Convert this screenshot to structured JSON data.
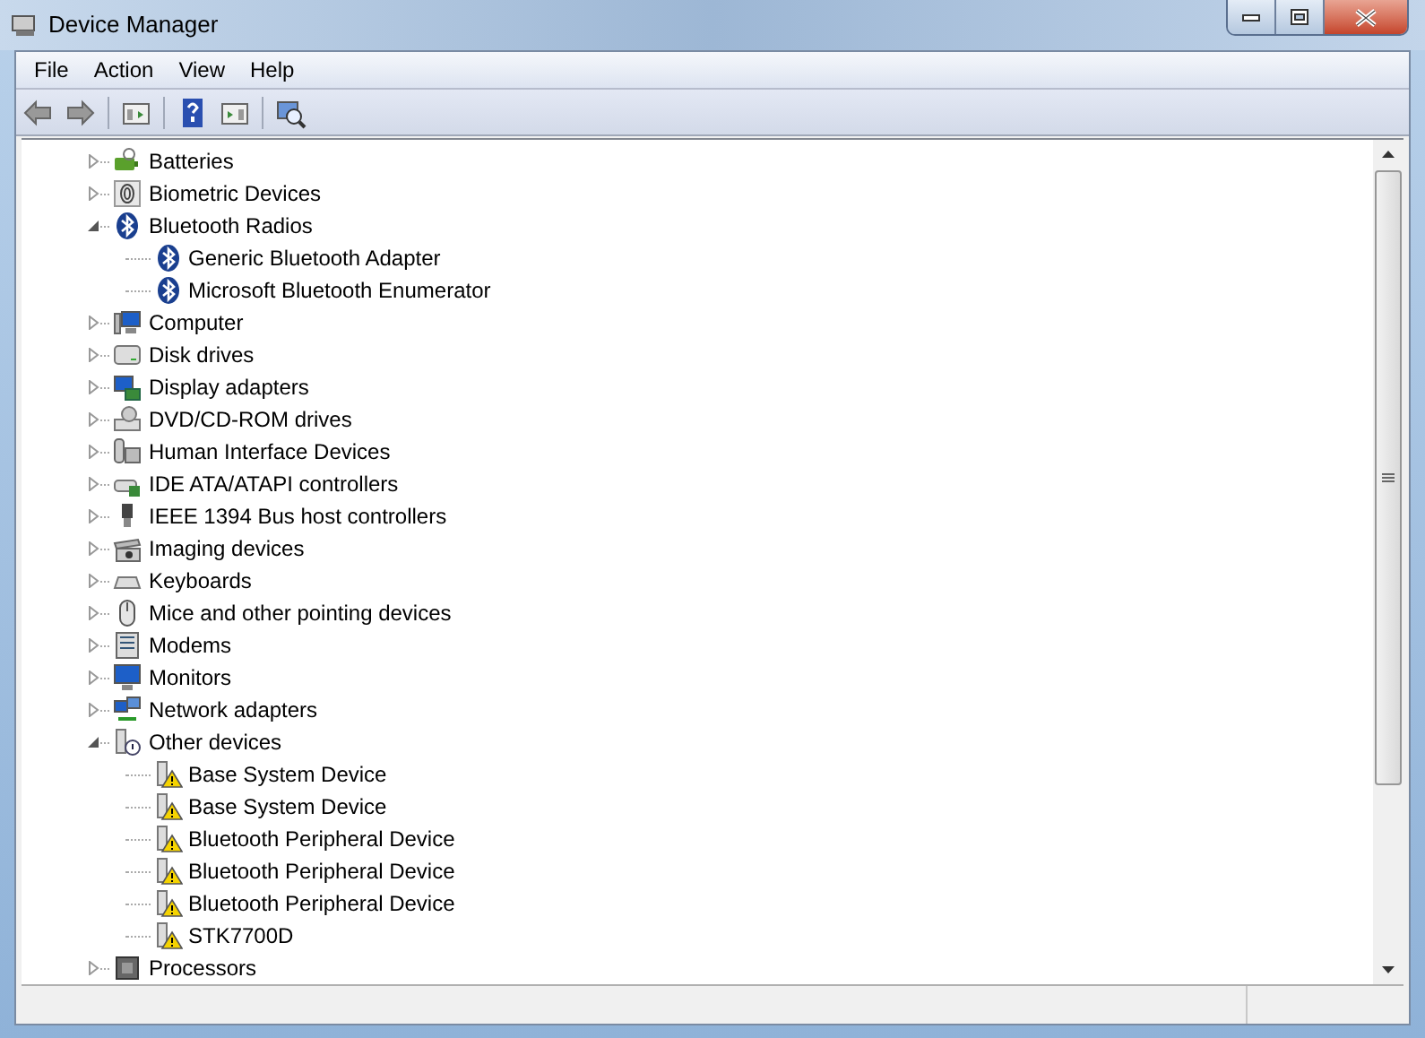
{
  "window": {
    "title": "Device Manager"
  },
  "menu": [
    "File",
    "Action",
    "View",
    "Help"
  ],
  "tree": {
    "items": [
      {
        "label": "Batteries",
        "expanded": false
      },
      {
        "label": "Biometric Devices",
        "expanded": false
      },
      {
        "label": "Bluetooth Radios",
        "expanded": true,
        "children": [
          {
            "label": "Generic Bluetooth Adapter"
          },
          {
            "label": "Microsoft Bluetooth Enumerator"
          }
        ]
      },
      {
        "label": "Computer",
        "expanded": false
      },
      {
        "label": "Disk drives",
        "expanded": false
      },
      {
        "label": "Display adapters",
        "expanded": false
      },
      {
        "label": "DVD/CD-ROM drives",
        "expanded": false
      },
      {
        "label": "Human Interface Devices",
        "expanded": false
      },
      {
        "label": "IDE ATA/ATAPI controllers",
        "expanded": false
      },
      {
        "label": "IEEE 1394 Bus host controllers",
        "expanded": false
      },
      {
        "label": "Imaging devices",
        "expanded": false
      },
      {
        "label": "Keyboards",
        "expanded": false
      },
      {
        "label": "Mice and other pointing devices",
        "expanded": false
      },
      {
        "label": "Modems",
        "expanded": false
      },
      {
        "label": "Monitors",
        "expanded": false
      },
      {
        "label": "Network adapters",
        "expanded": false
      },
      {
        "label": "Other devices",
        "expanded": true,
        "children": [
          {
            "label": "Base System Device"
          },
          {
            "label": "Base System Device"
          },
          {
            "label": "Bluetooth Peripheral Device"
          },
          {
            "label": "Bluetooth Peripheral Device"
          },
          {
            "label": "Bluetooth Peripheral Device"
          },
          {
            "label": "STK7700D"
          }
        ]
      },
      {
        "label": "Processors",
        "expanded": false
      }
    ]
  }
}
